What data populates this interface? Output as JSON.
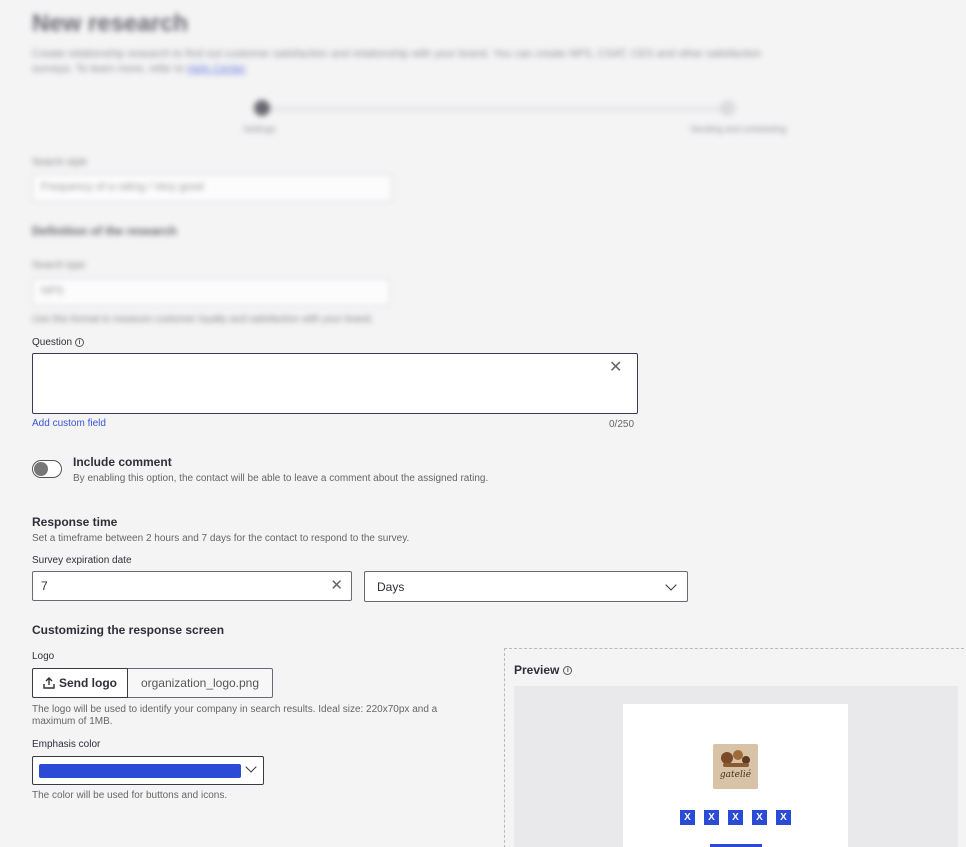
{
  "header": {
    "title": "New research",
    "subtitle": "Create relationship research to find out customer satisfaction and relationship with your brand. You can create NPS, CSAT, CES and other satisfaction surveys. To learn more, refer to",
    "subtitle_link": "Help Center"
  },
  "stepper": {
    "steps": [
      "Settings",
      "Sending and scheduling"
    ]
  },
  "search_type": {
    "label": "Search style",
    "value": "Frequency of a rating / Very good"
  },
  "definition": {
    "heading": "Definition of the research",
    "type_label": "Search type",
    "type_value": "NPS",
    "type_help": "Use this format to measure customer loyalty and satisfaction with your brand."
  },
  "question": {
    "label": "Question",
    "value": "",
    "counter": "0/250",
    "add_custom_field": "Add custom field"
  },
  "comment": {
    "title": "Include comment",
    "description": "By enabling this option, the contact will be able to leave a comment about the assigned rating."
  },
  "response_time": {
    "heading": "Response time",
    "description": "Set a timeframe between 2 hours and 7 days for the contact to respond to the survey.",
    "expiration_label": "Survey expiration date",
    "expiration_value": "7",
    "unit_value": "Days"
  },
  "customize": {
    "heading": "Customizing the response screen",
    "logo_label": "Logo",
    "send_logo": "Send logo",
    "file_name": "organization_logo.png",
    "logo_help": "The logo will be used to identify your company in search results. Ideal size: 220x70px and a maximum of 1MB.",
    "color_label": "Emphasis color",
    "color_value": "#2b4bd6",
    "color_help": "The color will be used for buttons and icons."
  },
  "preview": {
    "title": "Preview",
    "brand_text": "gatelié",
    "rating_labels": [
      "X",
      "X",
      "X",
      "X",
      "X"
    ]
  }
}
